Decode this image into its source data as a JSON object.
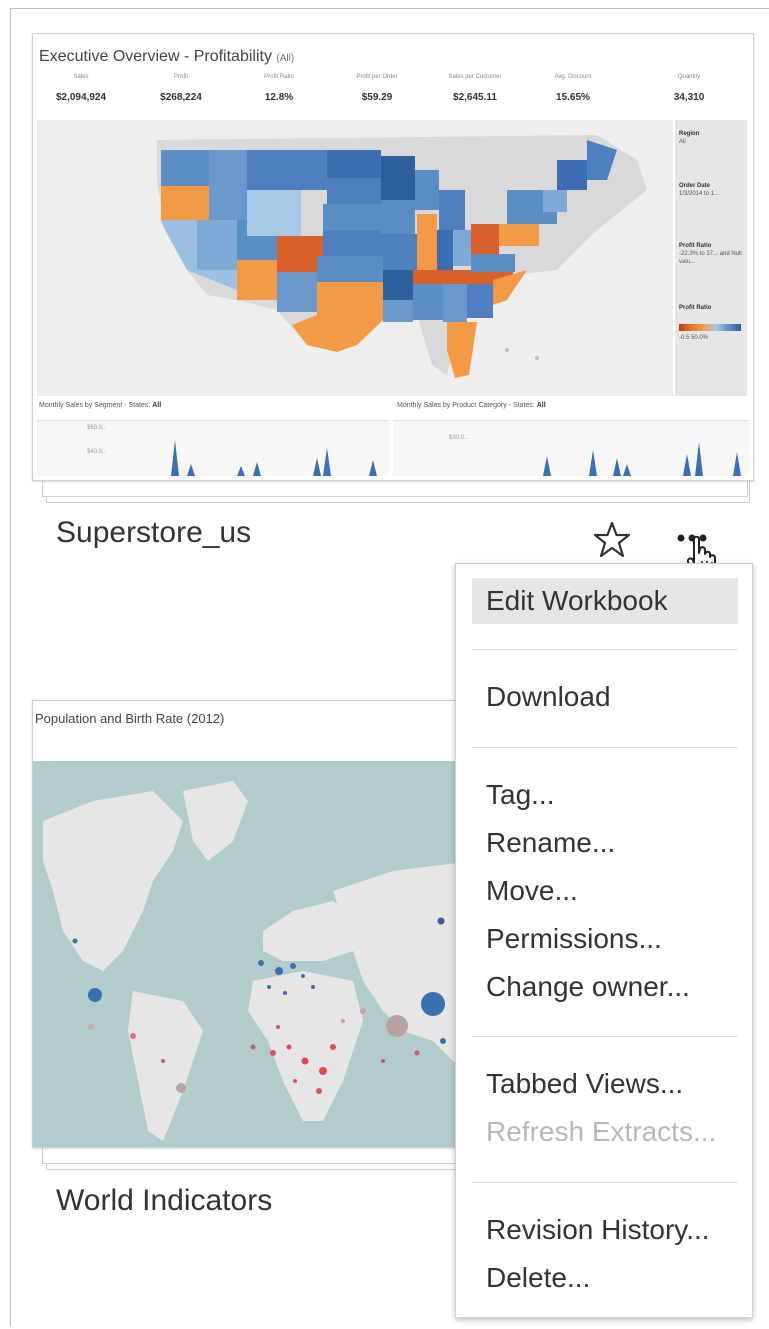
{
  "workbooks": [
    {
      "name": "Superstore_us",
      "thumbnail": {
        "title": "Executive Overview - Profitability",
        "title_suffix": "(All)",
        "kpis": [
          {
            "label": "Sales",
            "value": "$2,094,924"
          },
          {
            "label": "Profit",
            "value": "$268,224"
          },
          {
            "label": "Profit Ratio",
            "value": "12.8%"
          },
          {
            "label": "Profit per Order",
            "value": "$59.29"
          },
          {
            "label": "Sales per Customer",
            "value": "$2,645.11"
          },
          {
            "label": "Avg. Discount",
            "value": "15.65%"
          },
          {
            "label": "Quantity",
            "value": "34,310"
          }
        ],
        "filters": [
          {
            "label": "Region",
            "value": "All"
          },
          {
            "label": "Order Date",
            "value": "1/3/2014 to 1..."
          },
          {
            "label": "Profit Ratio",
            "value": "-22.3% to 37... and Null valu..."
          },
          {
            "label": "Profit Ratio",
            "value": "-0.5   50.0%"
          }
        ],
        "mini_charts": [
          {
            "title": "Monthly Sales by Segment - States:",
            "filter": "All",
            "ticks": [
              "$60.0..",
              "$40.0.."
            ]
          },
          {
            "title": "Monthly Sales by Product Category - States:",
            "filter": "All",
            "ticks": [
              "$30.0.."
            ]
          }
        ]
      }
    },
    {
      "name": "World Indicators",
      "thumbnail": {
        "title": "Population and Birth Rate (2012)"
      }
    }
  ],
  "icons": {
    "favorite": "star-outline-icon",
    "more": "more-actions-icon",
    "cursor": "hand-pointer-icon"
  },
  "menu": {
    "groups": [
      [
        {
          "label": "Edit Workbook",
          "highlighted": true,
          "disabled": false
        }
      ],
      [
        {
          "label": "Download",
          "highlighted": false,
          "disabled": false
        }
      ],
      [
        {
          "label": "Tag...",
          "highlighted": false,
          "disabled": false
        },
        {
          "label": "Rename...",
          "highlighted": false,
          "disabled": false
        },
        {
          "label": "Move...",
          "highlighted": false,
          "disabled": false
        },
        {
          "label": "Permissions...",
          "highlighted": false,
          "disabled": false
        },
        {
          "label": "Change owner...",
          "highlighted": false,
          "disabled": false
        }
      ],
      [
        {
          "label": "Tabbed Views...",
          "highlighted": false,
          "disabled": false
        },
        {
          "label": "Refresh Extracts...",
          "highlighted": false,
          "disabled": true
        }
      ],
      [
        {
          "label": "Revision History...",
          "highlighted": false,
          "disabled": false
        },
        {
          "label": "Delete...",
          "highlighted": false,
          "disabled": false
        }
      ]
    ]
  },
  "colors": {
    "map_blue": "#4f7fbf",
    "map_light_blue": "#8fb6dd",
    "map_orange": "#f39a47",
    "map_dark_orange": "#d8602a",
    "world_sea": "#b2cccc",
    "menu_highlight": "#e6e6e6"
  }
}
